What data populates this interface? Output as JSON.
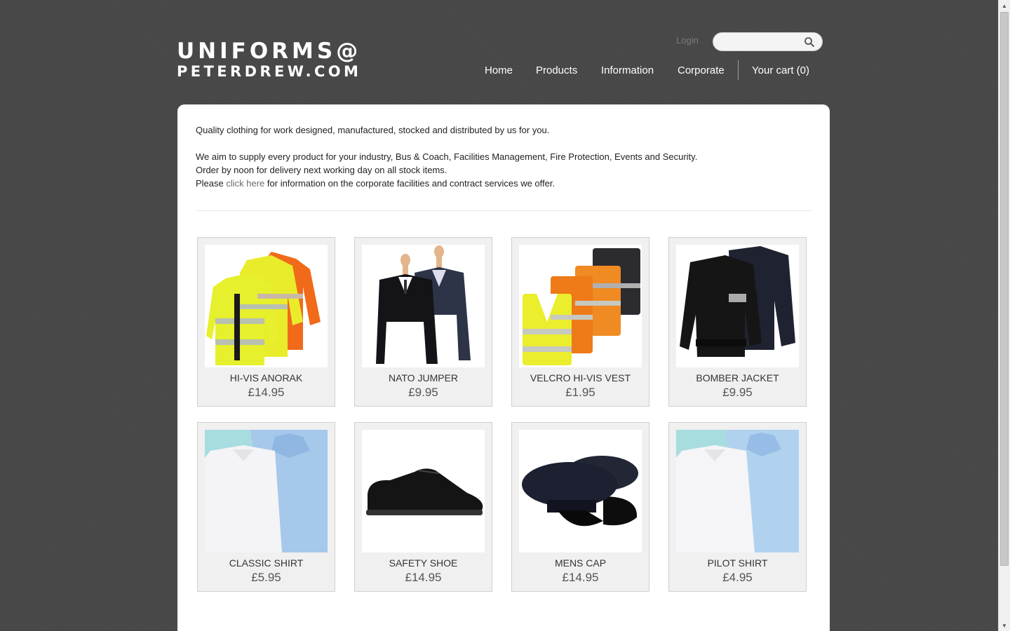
{
  "logo": {
    "line1": "UNIFORMS@",
    "line2": "PETERDREW.COM"
  },
  "header": {
    "login": "Login",
    "search_placeholder": "",
    "nav": {
      "home": "Home",
      "products": "Products",
      "information": "Information",
      "corporate": "Corporate",
      "cart": "Your cart (0)"
    }
  },
  "intro": {
    "line1": "Quality clothing for work designed, manufactured, stocked and distributed by us for you.",
    "line2": "We aim to supply every product for your industry, Bus & Coach, Facilities Management, Fire Protection, Events and Security.",
    "line3": "Order by noon for delivery next working day on all stock items.",
    "line4_pre": "Please ",
    "line4_link": "click here",
    "line4_post": " for information on the corporate facilities and contract services we offer."
  },
  "products": [
    {
      "name": "HI-VIS ANORAK",
      "price": "£14.95"
    },
    {
      "name": "NATO JUMPER",
      "price": "£9.95"
    },
    {
      "name": "VELCRO HI-VIS VEST",
      "price": "£1.95"
    },
    {
      "name": "BOMBER JACKET",
      "price": "£9.95"
    },
    {
      "name": "CLASSIC SHIRT",
      "price": "£5.95"
    },
    {
      "name": "SAFETY SHOE",
      "price": "£14.95"
    },
    {
      "name": "MENS CAP",
      "price": "£14.95"
    },
    {
      "name": "PILOT SHIRT",
      "price": "£4.95"
    }
  ]
}
